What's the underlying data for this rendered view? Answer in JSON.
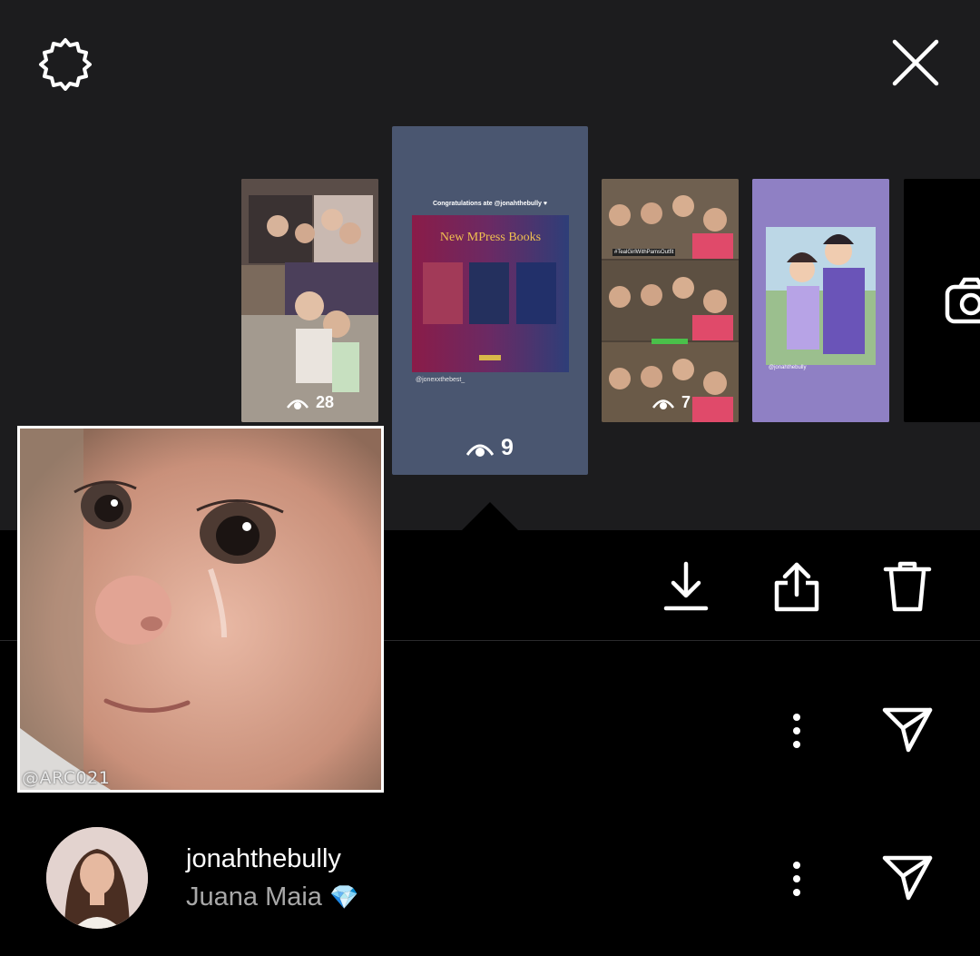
{
  "icons": {
    "settings": "gear-icon",
    "close": "close-icon",
    "download": "download-icon",
    "share": "share-icon",
    "delete": "trash-icon",
    "more": "more-vertical-icon",
    "send": "send-icon",
    "views": "eye-icon",
    "camera": "camera-icon",
    "badge": "diamond-icon"
  },
  "stories": [
    {
      "views": "28"
    },
    {
      "views": "9",
      "caption": "Congratulations ate @jonahthebully ♥",
      "card_title": "New MPress Books",
      "handle": "@jonexxthebest_"
    },
    {
      "views": "7",
      "tag": "#TealGirlWithPamsOutfit"
    },
    {
      "caption": "@jonahthebully"
    }
  ],
  "sticker": {
    "watermark": "@ARC021"
  },
  "viewer": {
    "username": "jonahthebully",
    "full_name": "Juana Maia",
    "badge_emoji": "💎"
  },
  "colors": {
    "top_background": "#1c1c1e",
    "background": "#000000",
    "selected_story": "#4a5670",
    "secondary_text": "#a8a8a8"
  }
}
